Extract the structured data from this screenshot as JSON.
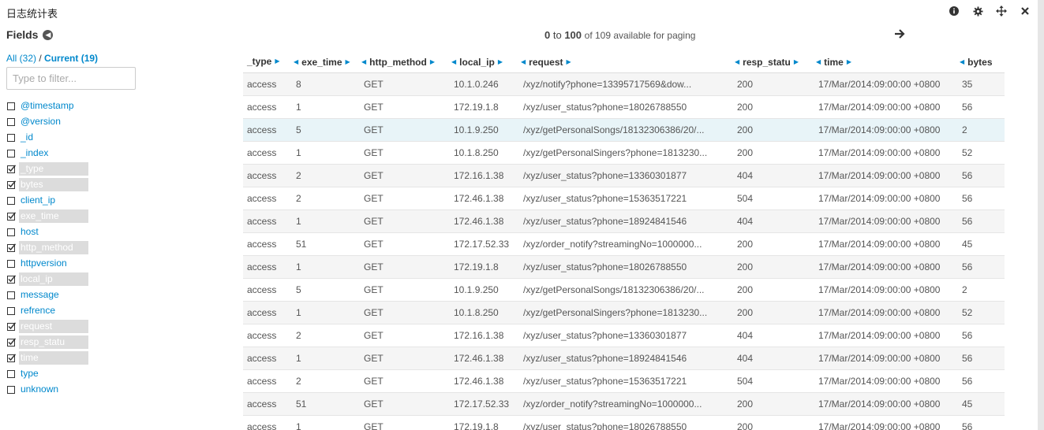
{
  "panel": {
    "title": "日志统计表"
  },
  "fields_panel": {
    "title": "Fields",
    "all_label": "All (32)",
    "sep": " / ",
    "current_label": "Current (19)",
    "filter_placeholder": "Type to filter...",
    "fields": [
      {
        "name": "@timestamp",
        "checked": false
      },
      {
        "name": "@version",
        "checked": false
      },
      {
        "name": "_id",
        "checked": false
      },
      {
        "name": "_index",
        "checked": false
      },
      {
        "name": "_type",
        "checked": true
      },
      {
        "name": "bytes",
        "checked": true
      },
      {
        "name": "client_ip",
        "checked": false
      },
      {
        "name": "exe_time",
        "checked": true
      },
      {
        "name": "host",
        "checked": false
      },
      {
        "name": "http_method",
        "checked": true
      },
      {
        "name": "httpversion",
        "checked": false
      },
      {
        "name": "local_ip",
        "checked": true
      },
      {
        "name": "message",
        "checked": false
      },
      {
        "name": "refrence",
        "checked": false
      },
      {
        "name": "request",
        "checked": true
      },
      {
        "name": "resp_statu",
        "checked": true
      },
      {
        "name": "time",
        "checked": true
      },
      {
        "name": "type",
        "checked": false
      },
      {
        "name": "unknown",
        "checked": false
      }
    ]
  },
  "paging": {
    "from": "0",
    "to_word": "to",
    "to": "100",
    "of_text": "of 109 available for paging"
  },
  "table": {
    "columns": [
      "_type",
      "exe_time",
      "http_method",
      "local_ip",
      "request",
      "resp_statu",
      "time",
      "bytes"
    ],
    "rows": [
      [
        "access",
        "8",
        "GET",
        "10.1.0.246",
        "/xyz/notify?phone=13395717569&dow...",
        "200",
        "17/Mar/2014:09:00:00 +0800",
        "35"
      ],
      [
        "access",
        "1",
        "GET",
        "172.19.1.8",
        "/xyz/user_status?phone=18026788550",
        "200",
        "17/Mar/2014:09:00:00 +0800",
        "56"
      ],
      [
        "access",
        "5",
        "GET",
        "10.1.9.250",
        "/xyz/getPersonalSongs/18132306386/20/...",
        "200",
        "17/Mar/2014:09:00:00 +0800",
        "2"
      ],
      [
        "access",
        "1",
        "GET",
        "10.1.8.250",
        "/xyz/getPersonalSingers?phone=1813230...",
        "200",
        "17/Mar/2014:09:00:00 +0800",
        "52"
      ],
      [
        "access",
        "2",
        "GET",
        "172.16.1.38",
        "/xyz/user_status?phone=13360301877",
        "404",
        "17/Mar/2014:09:00:00 +0800",
        "56"
      ],
      [
        "access",
        "2",
        "GET",
        "172.46.1.38",
        "/xyz/user_status?phone=15363517221",
        "504",
        "17/Mar/2014:09:00:00 +0800",
        "56"
      ],
      [
        "access",
        "1",
        "GET",
        "172.46.1.38",
        "/xyz/user_status?phone=18924841546",
        "404",
        "17/Mar/2014:09:00:00 +0800",
        "56"
      ],
      [
        "access",
        "51",
        "GET",
        "172.17.52.33",
        "/xyz/order_notify?streamingNo=1000000...",
        "200",
        "17/Mar/2014:09:00:00 +0800",
        "45"
      ],
      [
        "access",
        "1",
        "GET",
        "172.19.1.8",
        "/xyz/user_status?phone=18026788550",
        "200",
        "17/Mar/2014:09:00:00 +0800",
        "56"
      ],
      [
        "access",
        "5",
        "GET",
        "10.1.9.250",
        "/xyz/getPersonalSongs/18132306386/20/...",
        "200",
        "17/Mar/2014:09:00:00 +0800",
        "2"
      ],
      [
        "access",
        "1",
        "GET",
        "10.1.8.250",
        "/xyz/getPersonalSingers?phone=1813230...",
        "200",
        "17/Mar/2014:09:00:00 +0800",
        "52"
      ],
      [
        "access",
        "2",
        "GET",
        "172.16.1.38",
        "/xyz/user_status?phone=13360301877",
        "404",
        "17/Mar/2014:09:00:00 +0800",
        "56"
      ],
      [
        "access",
        "1",
        "GET",
        "172.46.1.38",
        "/xyz/user_status?phone=18924841546",
        "404",
        "17/Mar/2014:09:00:00 +0800",
        "56"
      ],
      [
        "access",
        "2",
        "GET",
        "172.46.1.38",
        "/xyz/user_status?phone=15363517221",
        "504",
        "17/Mar/2014:09:00:00 +0800",
        "56"
      ],
      [
        "access",
        "51",
        "GET",
        "172.17.52.33",
        "/xyz/order_notify?streamingNo=1000000...",
        "200",
        "17/Mar/2014:09:00:00 +0800",
        "45"
      ],
      [
        "access",
        "1",
        "GET",
        "172.19.1.8",
        "/xyz/user_status?phone=18026788550",
        "200",
        "17/Mar/2014:09:00:00 +0800",
        "56"
      ]
    ],
    "highlight_row": 2
  },
  "icons": [
    "info-icon",
    "gear-icon",
    "move-icon",
    "close-icon",
    "arrow-left-circle-icon",
    "arrow-right-icon"
  ],
  "colors": {
    "link": "#0088cc",
    "checked_bg": "#dcdcdc",
    "row_alt": "#f5f5f5",
    "row_hover": "#e8f4f8"
  }
}
